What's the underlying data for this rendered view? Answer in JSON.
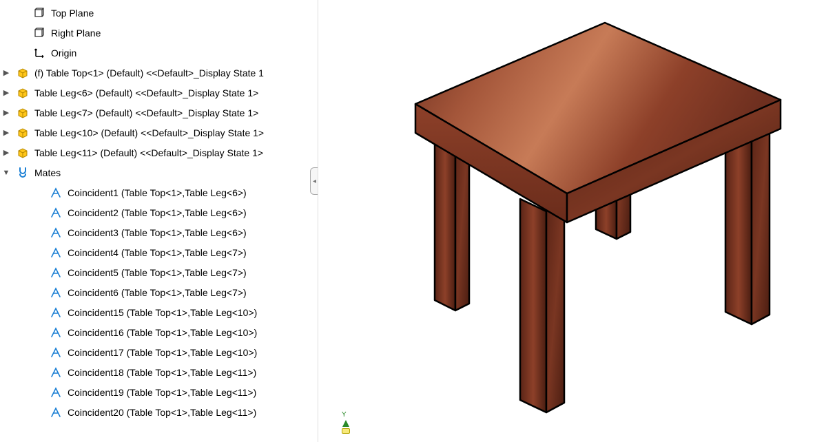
{
  "tree": {
    "planes": [
      {
        "name": "Top Plane"
      },
      {
        "name": "Right Plane"
      }
    ],
    "origin": {
      "name": "Origin"
    },
    "parts": [
      {
        "name": "(f) Table Top<1> (Default) <<Default>_Display State 1"
      },
      {
        "name": "Table Leg<6> (Default) <<Default>_Display State 1>"
      },
      {
        "name": "Table Leg<7> (Default) <<Default>_Display State 1>"
      },
      {
        "name": "Table Leg<10> (Default) <<Default>_Display State 1>"
      },
      {
        "name": "Table Leg<11> (Default) <<Default>_Display State 1>"
      }
    ],
    "mates_label": "Mates",
    "mates": [
      {
        "name": "Coincident1 (Table Top<1>,Table Leg<6>)"
      },
      {
        "name": "Coincident2 (Table Top<1>,Table Leg<6>)"
      },
      {
        "name": "Coincident3 (Table Top<1>,Table Leg<6>)"
      },
      {
        "name": "Coincident4 (Table Top<1>,Table Leg<7>)"
      },
      {
        "name": "Coincident5 (Table Top<1>,Table Leg<7>)"
      },
      {
        "name": "Coincident6 (Table Top<1>,Table Leg<7>)"
      },
      {
        "name": "Coincident15 (Table Top<1>,Table Leg<10>)"
      },
      {
        "name": "Coincident16 (Table Top<1>,Table Leg<10>)"
      },
      {
        "name": "Coincident17 (Table Top<1>,Table Leg<10>)"
      },
      {
        "name": "Coincident18 (Table Top<1>,Table Leg<11>)"
      },
      {
        "name": "Coincident19 (Table Top<1>,Table Leg<11>)"
      },
      {
        "name": "Coincident20 (Table Top<1>,Table Leg<11>)"
      }
    ]
  },
  "viewport": {
    "triad_axis": "Y",
    "model_description": "Wooden table (isometric view)"
  }
}
